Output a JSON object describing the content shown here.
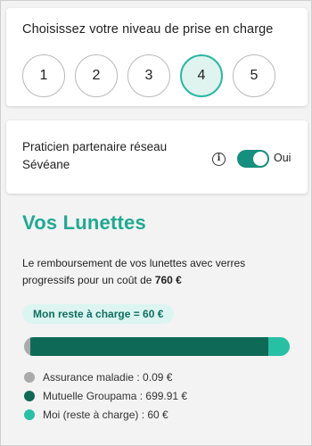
{
  "level_card": {
    "title": "Choisissez votre niveau de prise en charge",
    "levels": [
      "1",
      "2",
      "3",
      "4",
      "5"
    ],
    "selected": "4"
  },
  "partner": {
    "label": "Praticien partenaire réseau Sévéane",
    "info_icon": "info-icon",
    "toggle_on": true,
    "toggle_label": "Oui"
  },
  "lunettes": {
    "title": "Vos Lunettes",
    "description_prefix": "Le remboursement de vos lunettes avec verres progressifs pour un coût de ",
    "cost": "760 €",
    "reste_pill": "Mon reste à charge = 60 €",
    "breakdown": [
      {
        "label": "Assurance maladie : 0.09 €",
        "value": 0.09,
        "color": "#aaaaaa"
      },
      {
        "label": "Mutuelle Groupama : 699.91 €",
        "value": 699.91,
        "color": "#0e6a56"
      },
      {
        "label": "Moi (reste à charge) : 60 €",
        "value": 60,
        "color": "#27c0a4"
      }
    ],
    "total": 760
  },
  "colors": {
    "accent": "#1fa992",
    "toggle": "#158f7e",
    "selected_ring": "#2bb9a0"
  }
}
